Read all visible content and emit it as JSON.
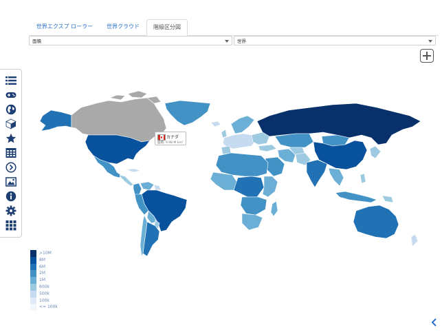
{
  "tabs": [
    {
      "label": "世界エクスプ ローラー",
      "active": false
    },
    {
      "label": "世界クラウド",
      "active": false
    },
    {
      "label": "階級区分図",
      "active": true
    }
  ],
  "selects": {
    "metric": {
      "value": "面積"
    },
    "region": {
      "value": "世界"
    }
  },
  "sidebar": {
    "items": [
      {
        "icon": "list-icon"
      },
      {
        "icon": "gamepad-icon"
      },
      {
        "icon": "globe-icon"
      },
      {
        "icon": "cube-icon"
      },
      {
        "icon": "star-icon"
      },
      {
        "icon": "table-icon"
      },
      {
        "icon": "chevron-right-circle-icon"
      },
      {
        "icon": "image-icon"
      },
      {
        "icon": "info-icon"
      },
      {
        "icon": "gear-icon"
      },
      {
        "icon": "grid-icon"
      }
    ]
  },
  "tooltip": {
    "country": "カナダ",
    "area_text": "面積: 9.98 M km²",
    "flag": "flag-canada"
  },
  "legend": {
    "items": [
      {
        "label": ">10M",
        "color": "#08306b"
      },
      {
        "label": "8M",
        "color": "#08519c"
      },
      {
        "label": "6M",
        "color": "#2171b5"
      },
      {
        "label": "2M",
        "color": "#4292c6"
      },
      {
        "label": "1M",
        "color": "#6baed6"
      },
      {
        "label": "600k",
        "color": "#9ecae1"
      },
      {
        "label": "500k",
        "color": "#c6dbef"
      },
      {
        "label": "100k",
        "color": "#deebf7"
      },
      {
        "label": "<= 100k",
        "color": "#f0f6fc"
      }
    ]
  },
  "colors": {
    "selected_country": "#a9a9a9",
    "tab_link": "#2a6fc9",
    "accent": "#2a6fc9"
  }
}
